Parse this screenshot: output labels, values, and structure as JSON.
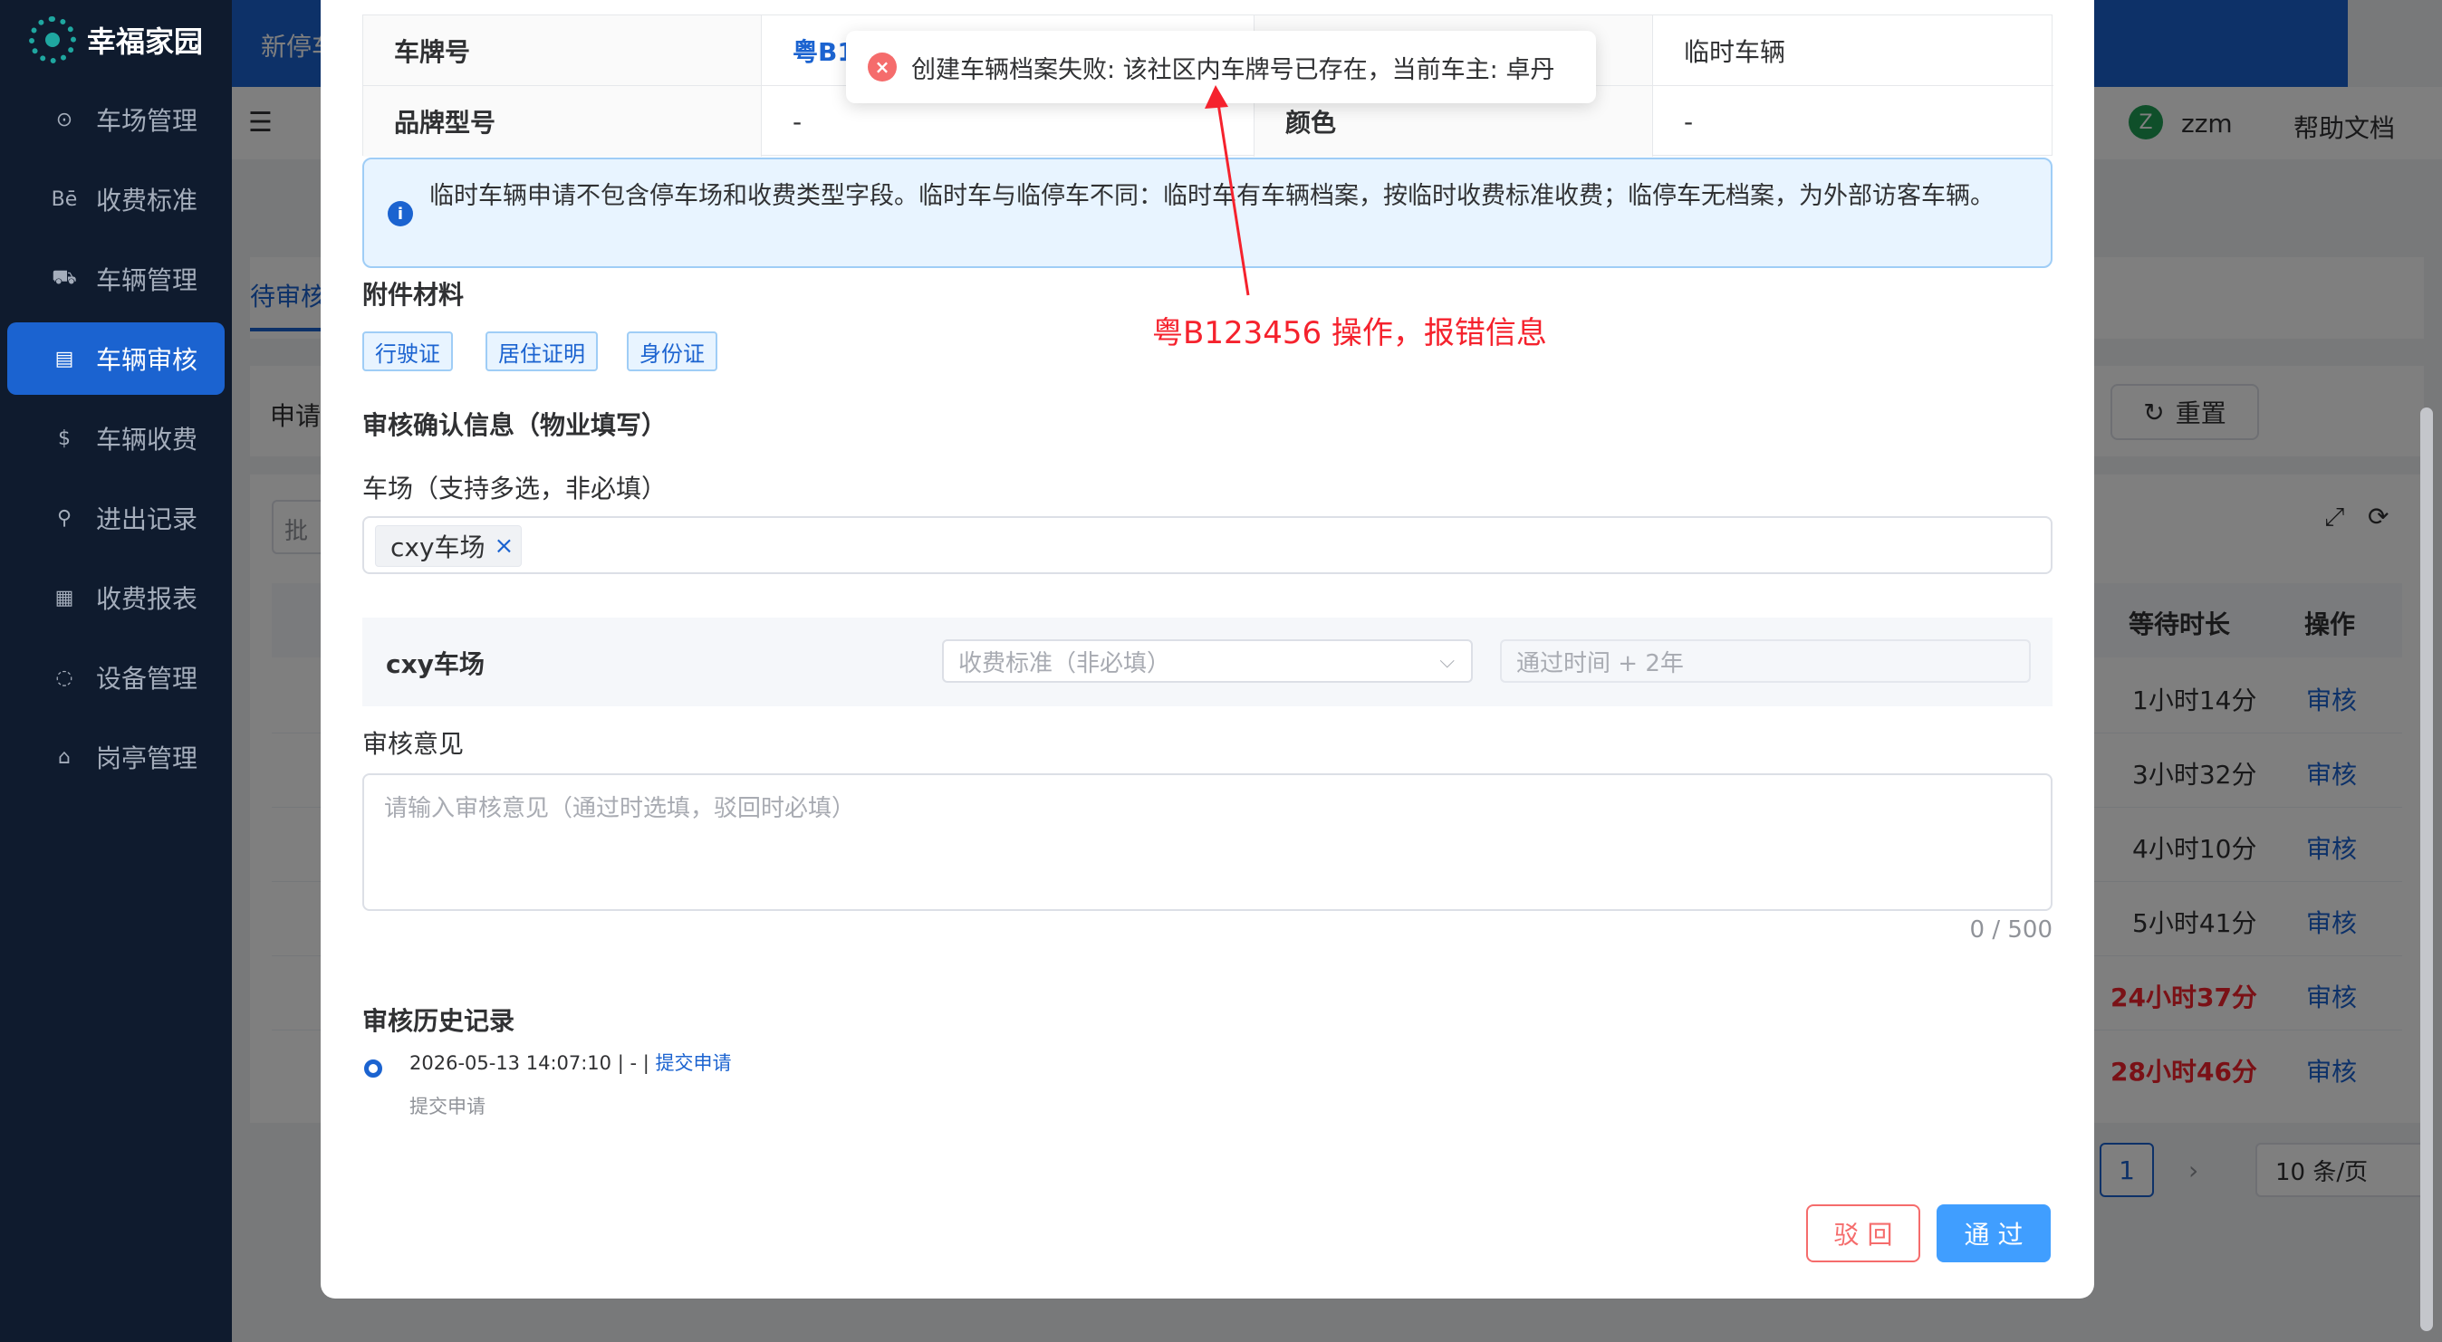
{
  "app": {
    "name": "幸福家园"
  },
  "sidebar": {
    "items": [
      {
        "label": "车场管理",
        "icon": "⊙"
      },
      {
        "label": "收费标准",
        "icon": "Bē"
      },
      {
        "label": "车辆管理",
        "icon": "⛟"
      },
      {
        "label": "车辆审核",
        "icon": "▤"
      },
      {
        "label": "车辆收费",
        "icon": "$"
      },
      {
        "label": "进出记录",
        "icon": "⚲"
      },
      {
        "label": "收费报表",
        "icon": "▦"
      },
      {
        "label": "设备管理",
        "icon": "◌"
      },
      {
        "label": "岗亭管理",
        "icon": "⌂"
      }
    ],
    "active_index": 3
  },
  "topbar": {
    "partial_text": "新停车"
  },
  "header": {
    "user_avatar": "Z",
    "user_name": "zzm",
    "help": "帮助文档"
  },
  "background": {
    "tab_pending": "待审核",
    "filter_label": "申请",
    "reset_button": "重置",
    "batch_label": "批",
    "table_headers": [
      "等待时长",
      "操作"
    ],
    "rows": [
      {
        "wait": "1小时14分",
        "action": "审核",
        "overdue": false
      },
      {
        "wait": "3小时32分",
        "action": "审核",
        "overdue": false
      },
      {
        "wait": "4小时10分",
        "action": "审核",
        "overdue": false
      },
      {
        "wait": "5小时41分",
        "action": "审核",
        "overdue": false
      },
      {
        "wait": "24小时37分",
        "action": "审核",
        "overdue": true
      },
      {
        "wait": "28小时46分",
        "action": "审核",
        "overdue": true
      }
    ],
    "pagination": {
      "current": "1",
      "page_size": "10 条/页"
    }
  },
  "modal": {
    "details": [
      {
        "label": "车牌号",
        "value": "粤B1"
      },
      {
        "label": "",
        "value": "临时车辆"
      },
      {
        "label": "品牌型号",
        "value": "-"
      },
      {
        "label": "颜色",
        "value": "-"
      }
    ],
    "info_alert": "临时车辆申请不包含停车场和收费类型字段。临时车与临停车不同：临时车有车辆档案，按临时收费标准收费；临停车无档案，为外部访客车辆。",
    "attachments_title": "附件材料",
    "attachments": [
      "行驶证",
      "居住证明",
      "身份证"
    ],
    "review_title": "审核确认信息（物业填写）",
    "lot_label": "车场（支持多选，非必填）",
    "selected_lot": "cxy车场",
    "lot_row": {
      "name": "cxy车场",
      "fee_placeholder": "收费标准（非必填）",
      "validity_placeholder": "通过时间 + 2年"
    },
    "opinion_label": "审核意见",
    "opinion_placeholder": "请输入审核意见（通过时选填，驳回时必填）",
    "opinion_counter": "0 / 500",
    "history_title": "审核历史记录",
    "history": [
      {
        "time": "2026-05-13 14:07:10 | - |",
        "action": "提交申请",
        "note": "提交申请"
      }
    ],
    "buttons": {
      "reject": "驳 回",
      "pass": "通 过"
    }
  },
  "toast": {
    "type": "error",
    "message": "创建车辆档案失败: 该社区内车牌号已存在，当前车主: 卓丹"
  },
  "annotation": {
    "text": "粤B123456 操作，报错信息",
    "color": "#f5222d"
  },
  "colors": {
    "primary": "#1b63d0",
    "sidebar": "#0f1b2e",
    "danger": "#f56c6c"
  }
}
